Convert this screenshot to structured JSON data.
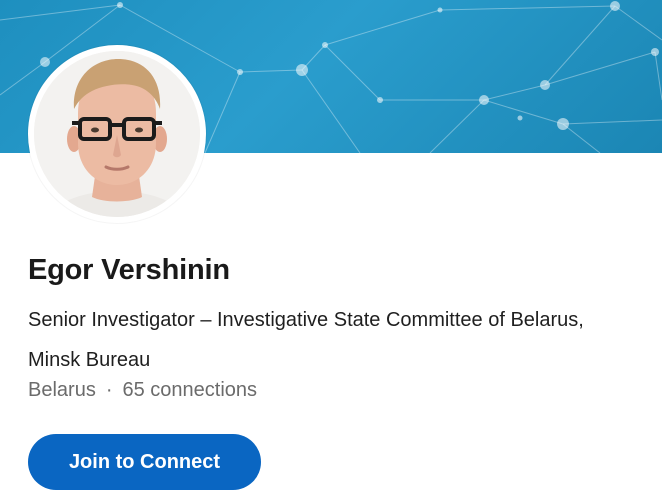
{
  "profile": {
    "name": "Egor Vershinin",
    "headline": "Senior Investigator – Investigative State Committee of Belarus, Minsk Bureau",
    "location": "Belarus",
    "separator": "·",
    "connections": "65 connections",
    "photo": "profile-photo"
  },
  "actions": {
    "connect_label": "Join to Connect"
  },
  "colors": {
    "banner": "#2a9dcd",
    "accent": "#0a66c2",
    "name_text": "#1a1a1a",
    "meta_text": "#6b6b6b"
  }
}
